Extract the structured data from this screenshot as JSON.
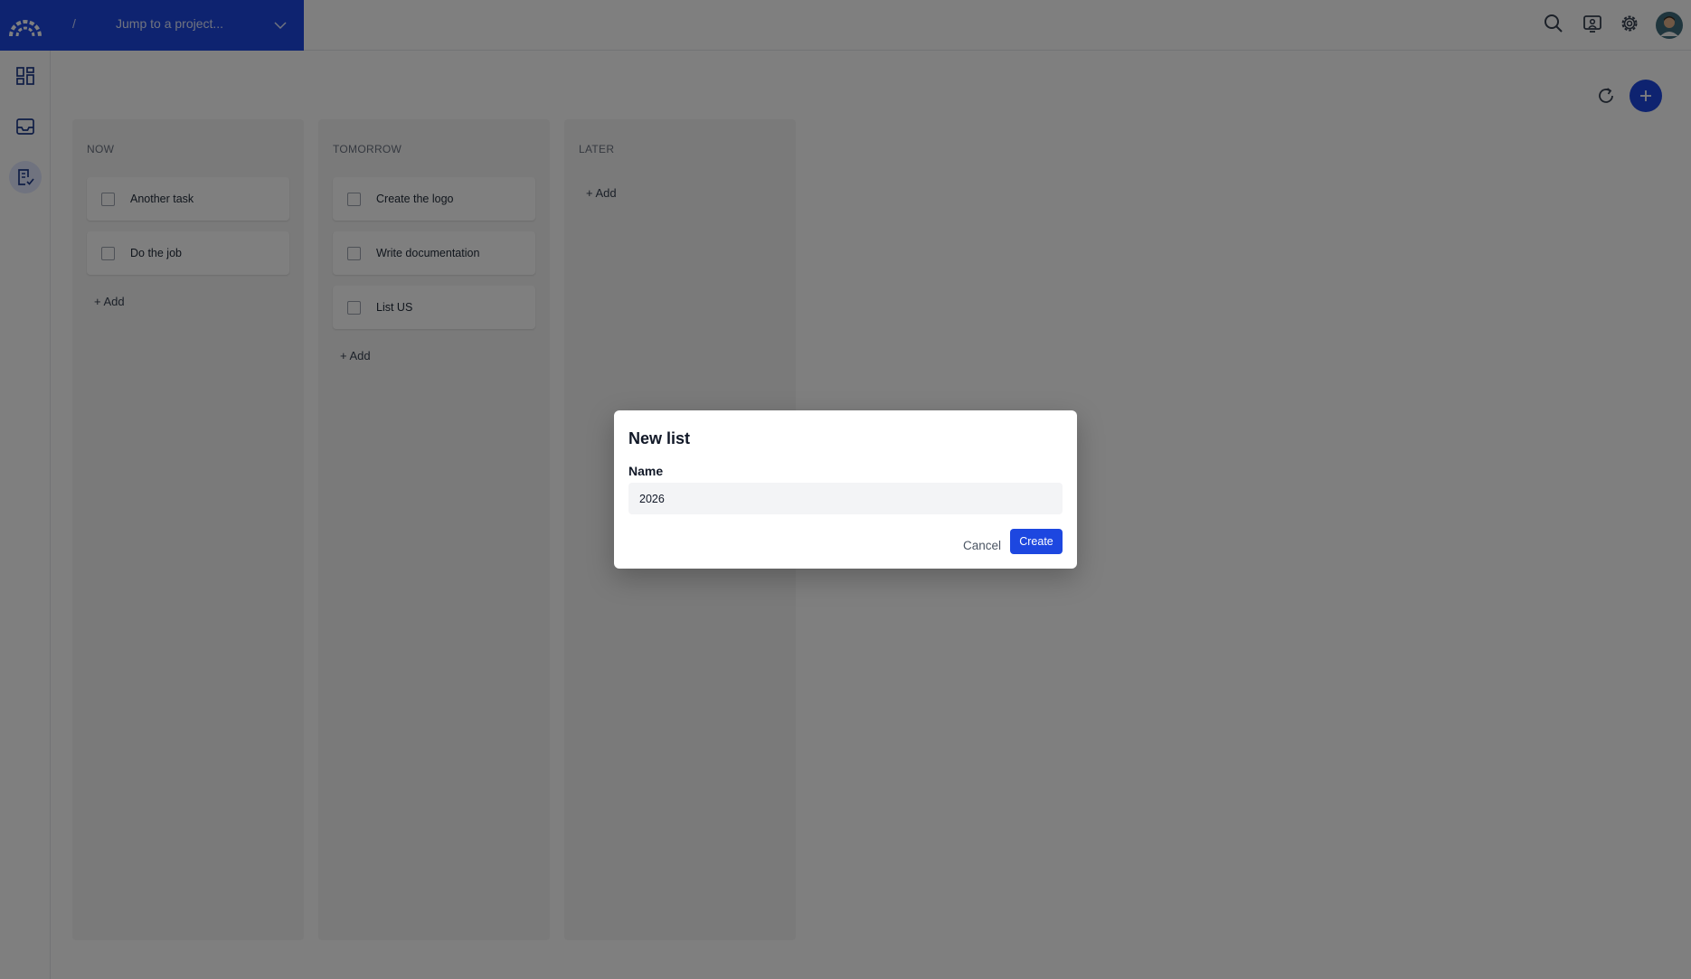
{
  "header": {
    "separator": "/",
    "project_jump": "Jump to a project..."
  },
  "sidebar": {
    "items": [
      {
        "icon": "dashboard-icon"
      },
      {
        "icon": "inbox-icon"
      },
      {
        "icon": "tasks-icon",
        "active": true
      }
    ]
  },
  "board": {
    "columns": [
      {
        "title": "NOW",
        "tasks": [
          "Another task",
          "Do the job"
        ],
        "add_label": "+ Add"
      },
      {
        "title": "TOMORROW",
        "tasks": [
          "Create the logo",
          "Write documentation",
          "List US"
        ],
        "add_label": "+ Add"
      },
      {
        "title": "LATER",
        "tasks": [],
        "add_label": "+ Add"
      }
    ]
  },
  "dialog": {
    "title": "New list",
    "field_label": "Name",
    "name_value": "2026",
    "cancel_label": "Cancel",
    "create_label": "Create"
  },
  "colors": {
    "brand": "#1d47e0",
    "overlay": "rgba(0,0,0,0.5)"
  }
}
